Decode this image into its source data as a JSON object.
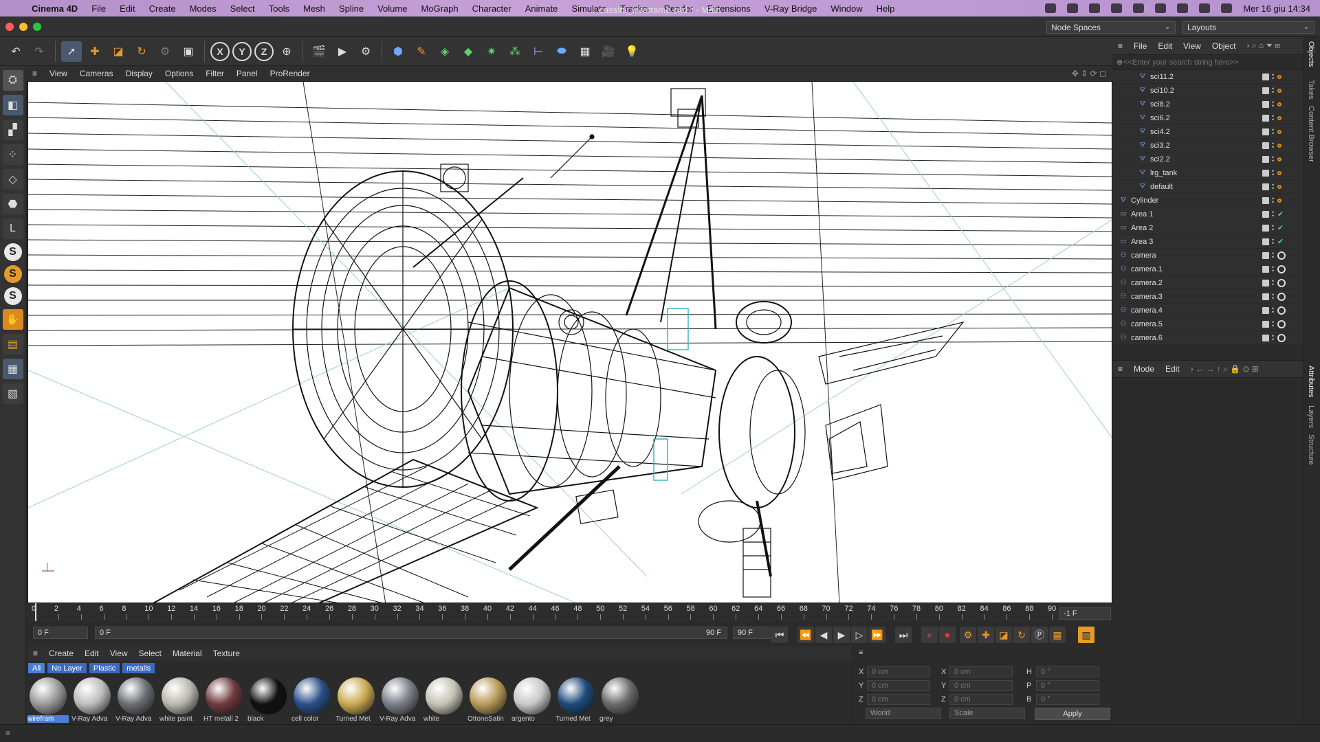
{
  "menubar": {
    "app": "Cinema 4D",
    "items": [
      "File",
      "Edit",
      "Create",
      "Modes",
      "Select",
      "Tools",
      "Mesh",
      "Spline",
      "Volume",
      "MoGraph",
      "Character",
      "Animate",
      "Simulate",
      "Tracker",
      "Render",
      "Extensions",
      "V-Ray Bridge",
      "Window",
      "Help"
    ],
    "clock": "Mer 16 giu  14:34"
  },
  "window": {
    "title": "cassini_wireframe.c4d * - Main",
    "node_spaces": "Node Spaces",
    "layouts": "Layouts"
  },
  "viewport": {
    "menu": [
      "View",
      "Cameras",
      "Display",
      "Options",
      "Filter",
      "Panel",
      "ProRender"
    ]
  },
  "timeline": {
    "ticks": [
      "0",
      "2",
      "4",
      "6",
      "8",
      "10",
      "12",
      "14",
      "16",
      "18",
      "20",
      "22",
      "24",
      "26",
      "28",
      "30",
      "32",
      "34",
      "36",
      "38",
      "40",
      "42",
      "44",
      "46",
      "48",
      "50",
      "52",
      "54",
      "56",
      "58",
      "60",
      "62",
      "64",
      "66",
      "68",
      "70",
      "72",
      "74",
      "76",
      "78",
      "80",
      "82",
      "84",
      "86",
      "88",
      "90"
    ],
    "current_frame_readout": "-1 F",
    "start_field": "0 F",
    "current_field": "0 F",
    "end_field": "90 F",
    "end_field2": "90 F"
  },
  "materials": {
    "menu": [
      "Create",
      "Edit",
      "View",
      "Select",
      "Material",
      "Texture"
    ],
    "filters": [
      "All",
      "No Layer",
      "Plastic",
      "metalls"
    ],
    "items": [
      {
        "label": "wirefram",
        "color": "#9a9a9a"
      },
      {
        "label": "V-Ray Adva",
        "color": "#bdbdbd"
      },
      {
        "label": "V-Ray Adva",
        "color": "#6b6f74"
      },
      {
        "label": "white paint",
        "color": "#b9b8ad"
      },
      {
        "label": "HT metall 2",
        "color": "#6e3a3e"
      },
      {
        "label": "black",
        "color": "#101010"
      },
      {
        "label": "cell color",
        "color": "#2a4f8a"
      },
      {
        "label": "Turned Met",
        "color": "#c9aa50"
      },
      {
        "label": "V-Ray Adva",
        "color": "#7a7f88"
      },
      {
        "label": "white",
        "color": "#c5c3b4"
      },
      {
        "label": "OttoneSatin",
        "color": "#b89a5a"
      },
      {
        "label": "argento",
        "color": "#c8c8c8"
      },
      {
        "label": "Turned Met",
        "color": "#1d4a7a"
      },
      {
        "label": "grey",
        "color": "#6b6b6b"
      }
    ]
  },
  "coordinates": {
    "rows": [
      {
        "a": "X",
        "av": "0 cm",
        "b": "X",
        "bv": "0 cm",
        "c": "H",
        "cv": "0 °"
      },
      {
        "a": "Y",
        "av": "0 cm",
        "b": "Y",
        "bv": "0 cm",
        "c": "P",
        "cv": "0 °"
      },
      {
        "a": "Z",
        "av": "0 cm",
        "b": "Z",
        "bv": "0 cm",
        "c": "B",
        "cv": "0 °"
      }
    ],
    "space": "World",
    "mode": "Scale",
    "apply": "Apply"
  },
  "objects": {
    "menu": [
      "File",
      "Edit",
      "View",
      "Object"
    ],
    "search_placeholder": "<<Enter your search string here>>",
    "rows": [
      {
        "name": "sci11.2",
        "indent": 2,
        "type": "poly"
      },
      {
        "name": "sci10.2",
        "indent": 2,
        "type": "poly"
      },
      {
        "name": "sci8.2",
        "indent": 2,
        "type": "poly"
      },
      {
        "name": "sci6.2",
        "indent": 2,
        "type": "poly"
      },
      {
        "name": "sci4.2",
        "indent": 2,
        "type": "poly"
      },
      {
        "name": "sci3.2",
        "indent": 2,
        "type": "poly"
      },
      {
        "name": "sci2.2",
        "indent": 2,
        "type": "poly"
      },
      {
        "name": "lrg_tank",
        "indent": 2,
        "type": "poly"
      },
      {
        "name": "default",
        "indent": 2,
        "type": "poly"
      },
      {
        "name": "Cylinder",
        "indent": 0,
        "type": "poly"
      },
      {
        "name": "Area 1",
        "indent": 0,
        "type": "light"
      },
      {
        "name": "Area 2",
        "indent": 0,
        "type": "light"
      },
      {
        "name": "Area 3",
        "indent": 0,
        "type": "light"
      },
      {
        "name": "camera",
        "indent": 0,
        "type": "camera"
      },
      {
        "name": "camera.1",
        "indent": 0,
        "type": "camera"
      },
      {
        "name": "camera.2",
        "indent": 0,
        "type": "camera"
      },
      {
        "name": "camera.3",
        "indent": 0,
        "type": "camera"
      },
      {
        "name": "camera.4",
        "indent": 0,
        "type": "camera"
      },
      {
        "name": "camera.5",
        "indent": 0,
        "type": "camera"
      },
      {
        "name": "camera.6",
        "indent": 0,
        "type": "camera"
      }
    ]
  },
  "attributes": {
    "menu": [
      "Mode",
      "Edit"
    ]
  },
  "side_tabs": [
    "Objects",
    "Takes",
    "Content Browser",
    "Attributes",
    "Layers",
    "Structure"
  ]
}
